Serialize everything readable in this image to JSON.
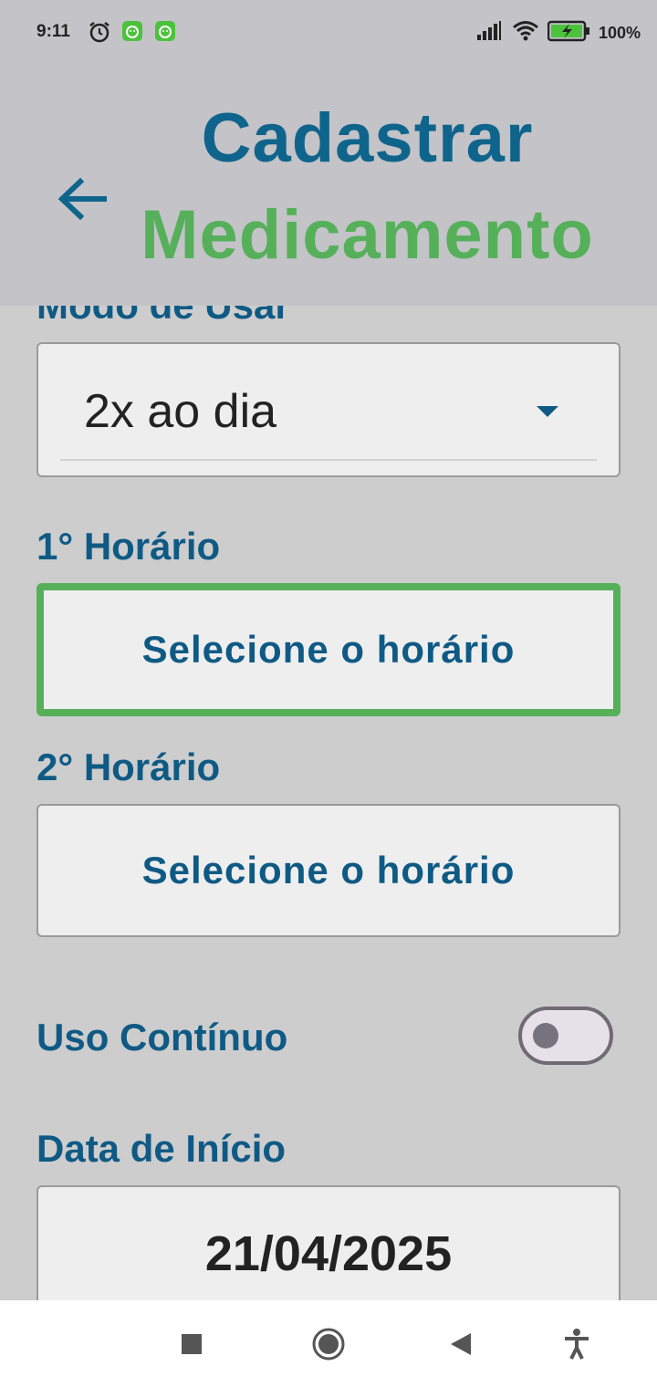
{
  "status_bar": {
    "time": "9:11",
    "battery_percent": "100%"
  },
  "header": {
    "title_line1": "Cadastrar",
    "title_line2": "Medicamento",
    "back_icon": "arrow-left-icon"
  },
  "form": {
    "mode_label": "Modo de Usar",
    "mode_value": "2x ao dia",
    "time1_label": "1° Horário",
    "time1_button": "Selecione o horário",
    "time2_label": "2° Horário",
    "time2_button": "Selecione o horário",
    "continuous_label": "Uso Contínuo",
    "continuous_on": false,
    "start_date_label": "Data de Início",
    "start_date_value": "21/04/2025"
  },
  "colors": {
    "primary_blue": "#0f648c",
    "accent_green": "#56b05a",
    "background": "#cdcdcd"
  }
}
